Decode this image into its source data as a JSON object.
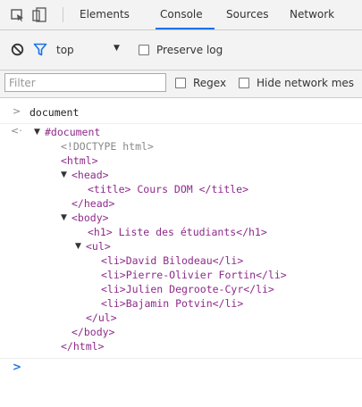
{
  "tabs": [
    "Elements",
    "Console",
    "Sources",
    "Network"
  ],
  "toolbar": {
    "context": "top",
    "preserve_log": "Preserve log"
  },
  "filter": {
    "placeholder": "Filter",
    "regex": "Regex",
    "hide_network": "Hide network mes"
  },
  "console": {
    "input_command": "document",
    "result_root": "#document",
    "lines": [
      "<!DOCTYPE html>",
      "<html>",
      "<head>",
      "<title> Cours DOM </title>",
      "</head>",
      "<body>",
      "<h1> Liste des étudiants</h1>",
      "<ul>",
      "<li>David Bilodeau</li>",
      "<li>Pierre-Olivier Fortin</li>",
      "<li>Julien Degroote-Cyr</li>",
      "<li>Bajamin Potvin</li>",
      "</ul>",
      "</body>",
      "</html>"
    ]
  },
  "colors": {
    "accent": "#1a73e8",
    "tag": "#8e2a8a",
    "toolbar_bg": "#f3f3f3"
  }
}
